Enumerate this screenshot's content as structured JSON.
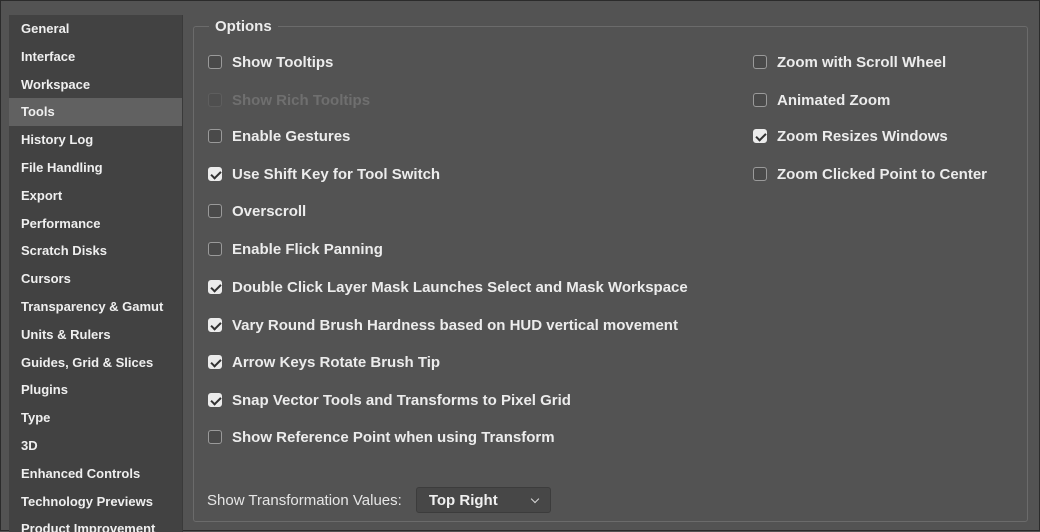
{
  "sidebar": {
    "items": [
      {
        "label": "General"
      },
      {
        "label": "Interface"
      },
      {
        "label": "Workspace"
      },
      {
        "label": "Tools",
        "selected": true
      },
      {
        "label": "History Log"
      },
      {
        "label": "File Handling"
      },
      {
        "label": "Export"
      },
      {
        "label": "Performance"
      },
      {
        "label": "Scratch Disks"
      },
      {
        "label": "Cursors"
      },
      {
        "label": "Transparency & Gamut"
      },
      {
        "label": "Units & Rulers"
      },
      {
        "label": "Guides, Grid & Slices"
      },
      {
        "label": "Plugins"
      },
      {
        "label": "Type"
      },
      {
        "label": "3D"
      },
      {
        "label": "Enhanced Controls"
      },
      {
        "label": "Technology Previews"
      },
      {
        "label": "Product Improvement"
      }
    ]
  },
  "options": {
    "title": "Options",
    "left": [
      {
        "label": "Show Tooltips",
        "checked": false,
        "enabled": true
      },
      {
        "label": "Show Rich Tooltips",
        "checked": false,
        "enabled": false
      },
      {
        "label": "Enable Gestures",
        "checked": false,
        "enabled": true
      },
      {
        "label": "Use Shift Key for Tool Switch",
        "checked": true,
        "enabled": true
      },
      {
        "label": "Overscroll",
        "checked": false,
        "enabled": true
      },
      {
        "label": "Enable Flick Panning",
        "checked": false,
        "enabled": true
      },
      {
        "label": "Double Click Layer Mask Launches Select and Mask Workspace",
        "checked": true,
        "enabled": true
      },
      {
        "label": "Vary Round Brush Hardness based on HUD vertical movement",
        "checked": true,
        "enabled": true
      },
      {
        "label": "Arrow Keys Rotate Brush Tip",
        "checked": true,
        "enabled": true
      },
      {
        "label": "Snap Vector Tools and Transforms to Pixel Grid",
        "checked": true,
        "enabled": true
      },
      {
        "label": "Show Reference Point when using Transform",
        "checked": false,
        "enabled": true
      }
    ],
    "right": [
      {
        "label": "Zoom with Scroll Wheel",
        "checked": false,
        "enabled": true
      },
      {
        "label": "Animated Zoom",
        "checked": false,
        "enabled": true
      },
      {
        "label": "Zoom Resizes Windows",
        "checked": true,
        "enabled": true
      },
      {
        "label": "Zoom Clicked Point to Center",
        "checked": false,
        "enabled": true
      }
    ],
    "transformation_values": {
      "label": "Show Transformation Values:",
      "selected": "Top Right"
    }
  }
}
